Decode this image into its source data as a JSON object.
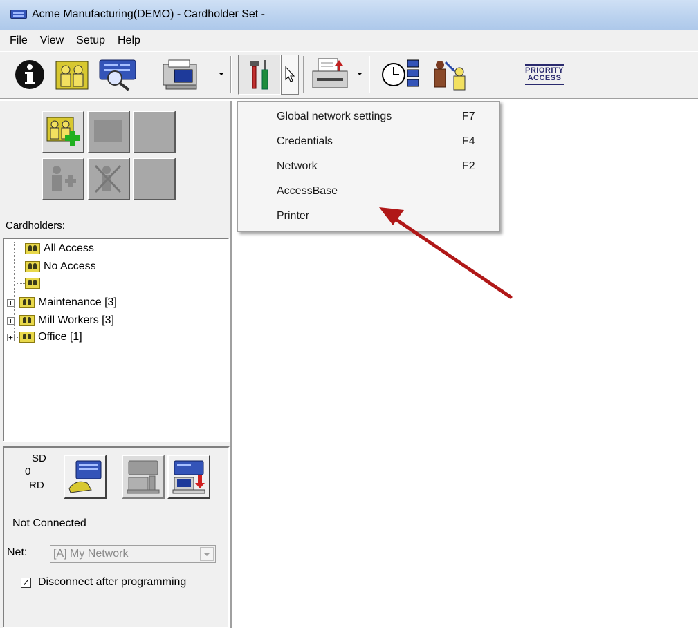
{
  "window": {
    "title": "Acme Manufacturing(DEMO) - Cardholder Set -"
  },
  "menubar": {
    "items": [
      "File",
      "View",
      "Setup",
      "Help"
    ]
  },
  "toolbar": {
    "priority_label_1": "PRIORITY",
    "priority_label_2": "ACCESS",
    "icons": [
      "info-icon",
      "cardholders-icon",
      "search-network-icon",
      "printer-computer-icon",
      "tools-icon",
      "pointer-icon",
      "report-printer-icon",
      "schedule-clock-icon",
      "priority-person-icon",
      "priority-access-icon"
    ]
  },
  "dropdown": {
    "items": [
      {
        "label": "Global  network settings",
        "shortcut": "F7"
      },
      {
        "label": "Credentials",
        "shortcut": "F4"
      },
      {
        "label": "Network",
        "shortcut": "F2"
      },
      {
        "label": "AccessBase",
        "shortcut": ""
      },
      {
        "label": "Printer",
        "shortcut": ""
      }
    ]
  },
  "leftpanel": {
    "cardholders_label": "Cardholders:",
    "tree": [
      {
        "label": "All Access",
        "expandable": false
      },
      {
        "label": "No Access",
        "expandable": false
      },
      {
        "label": "",
        "expandable": false
      },
      {
        "label": "Maintenance [3]",
        "expandable": true
      },
      {
        "label": "Mill Workers [3]",
        "expandable": true
      },
      {
        "label": "Office [1]",
        "expandable": true
      }
    ],
    "expander_symbol": "+",
    "sd_label": "SD",
    "sd_count": "0",
    "rd_label": "RD",
    "status": "Not Connected",
    "net_label": "Net:",
    "net_value": "[A] My Network",
    "disconnect_label": "Disconnect after programming",
    "disconnect_checked": "✓"
  },
  "colors": {
    "annotation_arrow": "#b01818",
    "titlebar": "#b9d1ee",
    "folder": "#e8d84a"
  }
}
